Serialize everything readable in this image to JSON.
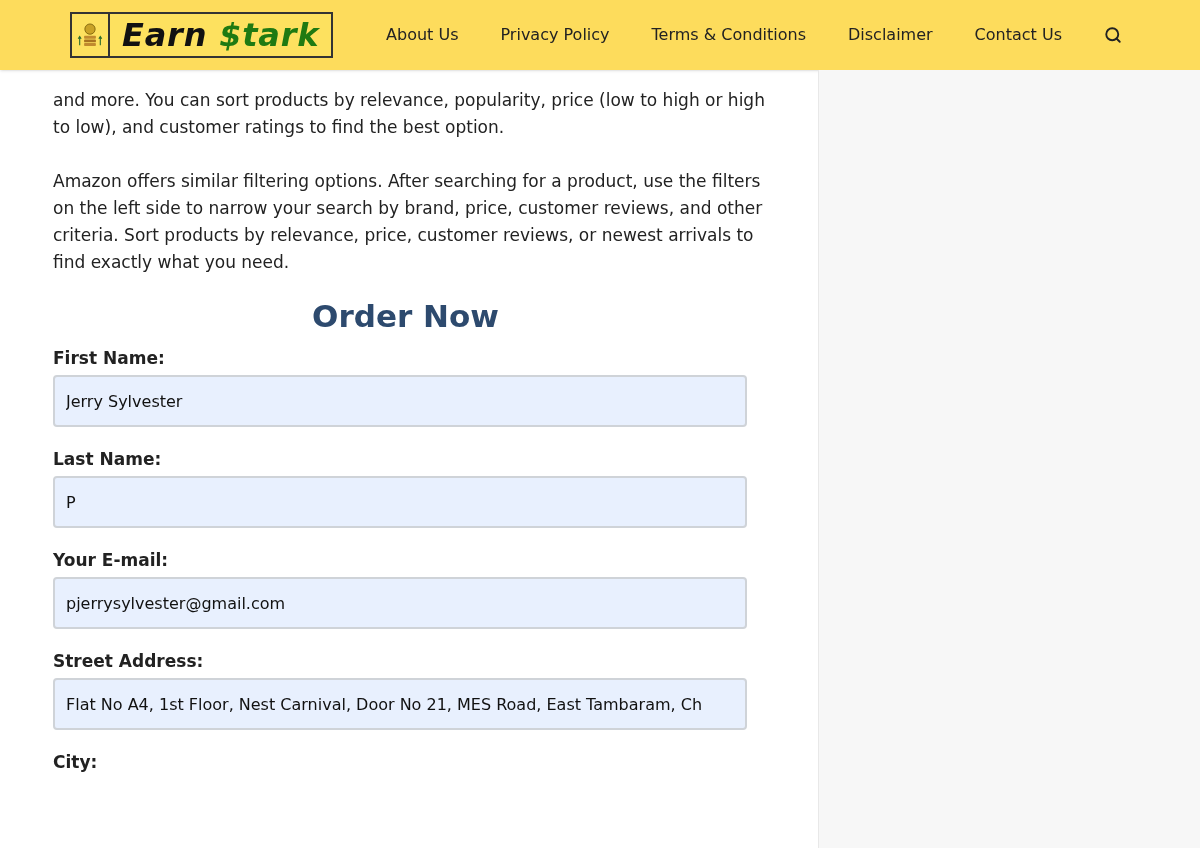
{
  "header": {
    "logo": {
      "word_1": "Earn",
      "word_2": "$tark"
    },
    "nav": [
      "About Us",
      "Privacy Policy",
      "Terms & Conditions",
      "Disclaimer",
      "Contact Us"
    ]
  },
  "paragraphs": [
    "and more. You can sort products by relevance, popularity, price (low to high or high to low), and customer ratings to find the best option.",
    "Amazon offers similar filtering options. After searching for a product, use the filters on the left side to narrow your search by brand, price, customer reviews, and other criteria. Sort products by relevance, price, customer reviews, or newest arrivals to find exactly what you need."
  ],
  "form": {
    "title": "Order Now",
    "fields": [
      {
        "label": "First Name:",
        "value": "Jerry Sylvester"
      },
      {
        "label": "Last Name:",
        "value": "P"
      },
      {
        "label": "Your E-mail:",
        "value": "pjerrysylvester@gmail.com"
      },
      {
        "label": "Street Address:",
        "value": "Flat No A4, 1st Floor, Nest Carnival, Door No 21, MES Road, East Tambaram, Ch"
      },
      {
        "label": "City:"
      }
    ]
  }
}
